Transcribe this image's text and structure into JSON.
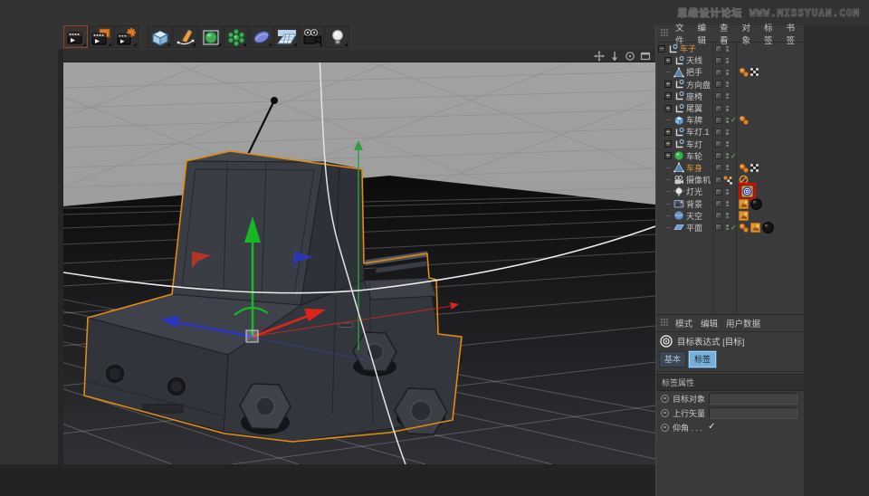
{
  "watermark": {
    "site_name": "思缘设计论坛",
    "site_url": "WWW.MISSYUAN.COM"
  },
  "colors": {
    "selection_outline": "#e08c10",
    "selected_text": "#e2973d",
    "highlight_box": "#e80200",
    "axis_x": "#e02419",
    "axis_y": "#17b823",
    "axis_z": "#2936c8",
    "enabled_check": "#62c24e",
    "tag_orange": "#e0952d"
  },
  "toolbar": {
    "icons": [
      {
        "name": "render-view-icon",
        "selected": true
      },
      {
        "name": "render-to-picture-viewer-icon",
        "selected": false
      },
      {
        "name": "edit-render-settings-icon",
        "selected": false
      },
      {
        "name": "cube-primitive-icon",
        "selected": false,
        "group_start": true
      },
      {
        "name": "pen-spline-icon",
        "selected": false
      },
      {
        "name": "subdivision-surface-icon",
        "selected": false
      },
      {
        "name": "array-generator-icon",
        "selected": false
      },
      {
        "name": "bend-deformer-icon",
        "selected": false
      },
      {
        "name": "floor-object-icon",
        "selected": false
      },
      {
        "name": "camera-object-icon",
        "selected": false
      },
      {
        "name": "light-object-icon",
        "selected": false
      }
    ]
  },
  "viewport": {
    "nav_icons": [
      "pan-icon",
      "dolly-icon",
      "rotate-icon",
      "toggle-view-icon"
    ]
  },
  "object_manager": {
    "menu": [
      "文件",
      "编辑",
      "查看",
      "对象",
      "标签",
      "书签"
    ],
    "objects": [
      {
        "name": "车子",
        "depth": 0,
        "expander": "minus",
        "icon": "null",
        "selected": true,
        "check": false,
        "state": "dots",
        "tags": []
      },
      {
        "name": "天线",
        "depth": 1,
        "expander": "plus",
        "icon": "null",
        "selected": false,
        "check": false,
        "state": "dots",
        "tags": []
      },
      {
        "name": "把手",
        "depth": 1,
        "expander": "leaf",
        "icon": "poly",
        "selected": false,
        "check": false,
        "state": "dots",
        "tags": [
          "phong",
          "texture-x"
        ]
      },
      {
        "name": "方向盘",
        "depth": 1,
        "expander": "plus",
        "icon": "null",
        "selected": false,
        "check": false,
        "state": "dots",
        "tags": []
      },
      {
        "name": "座椅",
        "depth": 1,
        "expander": "plus",
        "icon": "null",
        "selected": false,
        "check": false,
        "state": "dots",
        "tags": []
      },
      {
        "name": "尾翼",
        "depth": 1,
        "expander": "plus",
        "icon": "null",
        "selected": false,
        "check": false,
        "state": "dots",
        "tags": []
      },
      {
        "name": "车牌",
        "depth": 1,
        "expander": "leaf",
        "icon": "cube",
        "selected": false,
        "check": true,
        "state": "dots",
        "tags": [
          "phong"
        ]
      },
      {
        "name": "车灯.1",
        "depth": 1,
        "expander": "plus",
        "icon": "null",
        "selected": false,
        "check": false,
        "state": "dots",
        "tags": []
      },
      {
        "name": "车灯",
        "depth": 1,
        "expander": "plus",
        "icon": "null",
        "selected": false,
        "check": false,
        "state": "dots",
        "tags": []
      },
      {
        "name": "车轮",
        "depth": 1,
        "expander": "plus",
        "icon": "sphere",
        "selected": false,
        "check": true,
        "state": "dots",
        "tags": []
      },
      {
        "name": "车身",
        "depth": 1,
        "expander": "leaf",
        "icon": "poly",
        "selected": true,
        "check": false,
        "state": "dots",
        "tags": [
          "phong",
          "texture-x"
        ]
      },
      {
        "name": "摄像机",
        "depth": 1,
        "expander": "leaf",
        "icon": "camera",
        "selected": false,
        "check": false,
        "state": "checker",
        "tags": [
          "prohibition"
        ]
      },
      {
        "name": "灯光",
        "depth": 1,
        "expander": "leaf",
        "icon": "light",
        "selected": false,
        "check": false,
        "state": "dots",
        "tags": [
          "target"
        ],
        "highlight_tag": "target"
      },
      {
        "name": "背景",
        "depth": 1,
        "expander": "leaf",
        "icon": "background",
        "selected": false,
        "check": false,
        "state": "dots",
        "tags": [
          "texture",
          "material"
        ]
      },
      {
        "name": "天空",
        "depth": 1,
        "expander": "leaf",
        "icon": "sky",
        "selected": false,
        "check": false,
        "state": "dots",
        "tags": [
          "texture"
        ]
      },
      {
        "name": "平面",
        "depth": 1,
        "expander": "leaf",
        "icon": "plane",
        "selected": false,
        "check": true,
        "state": "dots",
        "tags": [
          "phong",
          "texture",
          "material"
        ]
      }
    ]
  },
  "attribute_manager": {
    "menu": [
      "模式",
      "编辑",
      "用户数据"
    ],
    "title": "目标表达式 [目标]",
    "tabs": [
      {
        "label": "基本",
        "active": false
      },
      {
        "label": "标签",
        "active": true
      }
    ],
    "section": "标签属性",
    "properties": [
      {
        "label": "目标对象",
        "type": "field",
        "value": ""
      },
      {
        "label": "上行矢量",
        "type": "field",
        "value": ""
      },
      {
        "label": "仰角 . . .",
        "type": "checkbox",
        "checked": true,
        "check_glyph": "✓"
      }
    ]
  }
}
